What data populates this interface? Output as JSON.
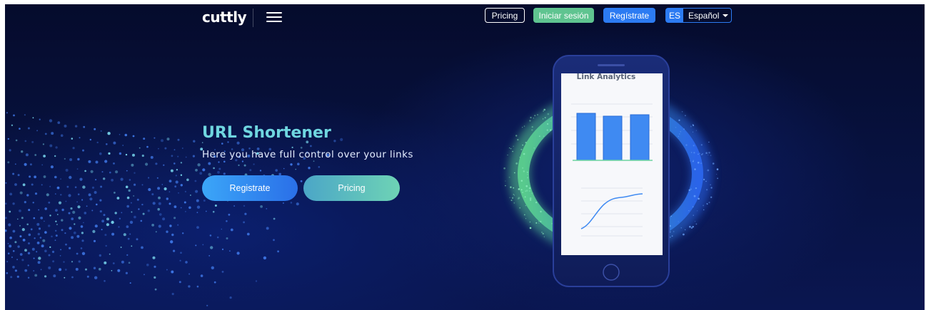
{
  "header": {
    "logo": "cuttly",
    "menu_icon": "hamburger-menu-icon",
    "pricing": "Pricing",
    "login": "Iniciar sesión",
    "register": "Regístrate",
    "language": {
      "code": "ES",
      "name": "Español"
    }
  },
  "hero": {
    "title": "URL Shortener",
    "subtitle": "Here you have full control over your links",
    "cta_register": "Registrate",
    "cta_pricing": "Pricing"
  },
  "phone": {
    "chart_title": "Link Analytics"
  },
  "colors": {
    "background": "#07113d",
    "title": "#6fd6e0",
    "login_button": "#5fc490",
    "register_button": "#2c7bf2",
    "ring_green": "#5cd38f",
    "ring_blue": "#2b67f0"
  }
}
